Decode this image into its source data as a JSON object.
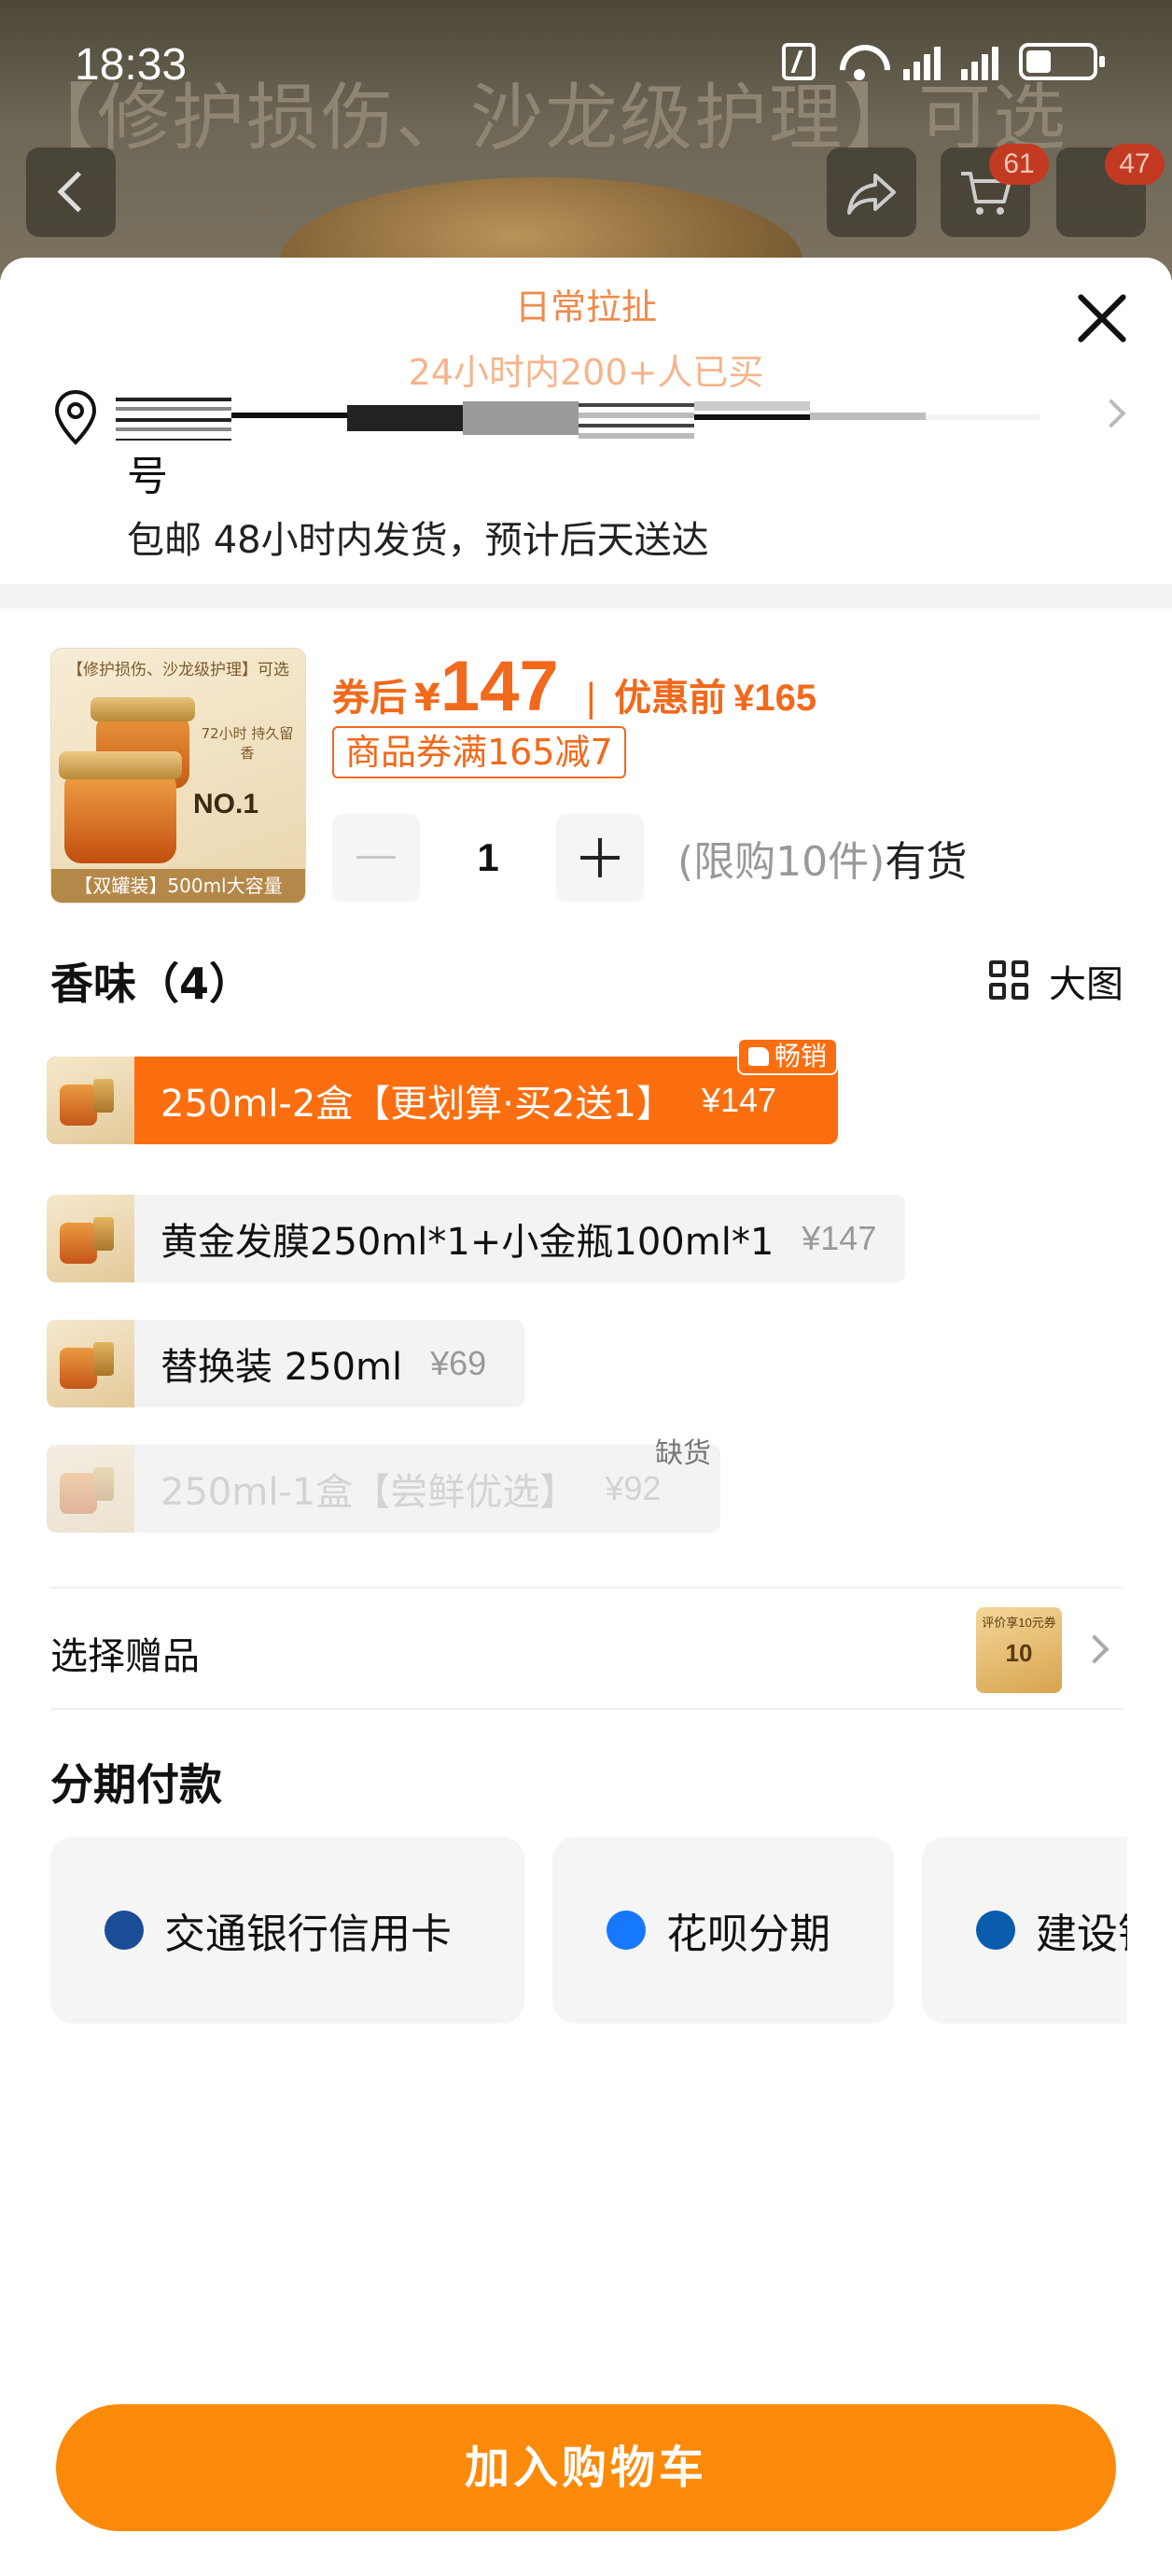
{
  "status": {
    "time": "18:33"
  },
  "background": {
    "title_text": "【修护损伤、沙龙级护理】可选",
    "cart_badge": "61",
    "more_badge": "47"
  },
  "sheet": {
    "title": "日常拉扯",
    "subtitle": "24小时内200+人已买",
    "address_suffix": "号",
    "shipping": "包邮 48小时内发货，预计后天送达"
  },
  "product": {
    "thumb_title": "【修护损伤、沙龙级护理】可选",
    "thumb_tag": "72小时 持久留香",
    "thumb_badge": "NO.1",
    "thumb_footer": "【双罐装】500ml大容量",
    "price_label": "券后",
    "currency": "¥",
    "price": "147",
    "separator": "|",
    "before_label": "优惠前",
    "before_price": "¥165",
    "coupon": "商品券满165减7",
    "quantity": "1",
    "limit": "(限购10件)",
    "stock": "有货"
  },
  "options": {
    "title": "香味（4）",
    "big_pic_label": "大图",
    "items": [
      {
        "label": "250ml-2盒【更划算·买2送1】",
        "price": "¥147",
        "badge": "畅销",
        "state": "selected"
      },
      {
        "label": "黄金发膜250ml*1+小金瓶100ml*1",
        "price": "¥147",
        "state": "normal"
      },
      {
        "label": "替换装 250ml",
        "price": "¥69",
        "state": "normal"
      },
      {
        "label": "250ml-1盒【尝鲜优选】",
        "price": "¥92",
        "badge": "缺货",
        "state": "disabled"
      }
    ]
  },
  "gift": {
    "label": "选择赠品",
    "thumb_text": "评价享10元券",
    "thumb_value": "10"
  },
  "installment": {
    "title": "分期付款",
    "cards": [
      {
        "name": "交通银行信用卡",
        "color": "#1a4c97"
      },
      {
        "name": "花呗分期",
        "color": "#1677ff"
      },
      {
        "name": "建设银行",
        "color": "#0a5cad"
      }
    ]
  },
  "cta": {
    "add_to_cart": "加入购物车",
    "color": "#fc8a0a"
  },
  "colors": {
    "accent": "#fb6e10",
    "price": "#f2691b"
  }
}
